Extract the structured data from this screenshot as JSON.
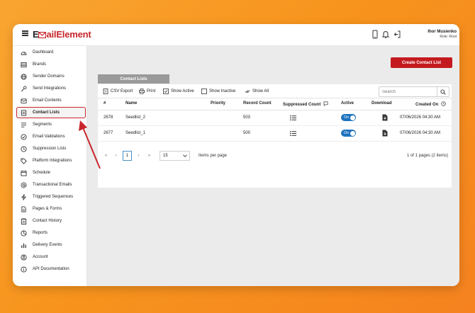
{
  "app": {
    "logo_part1": "E",
    "logo_part2": "ailElement",
    "brand_color": "#c8262b"
  },
  "header": {
    "user_name": "Ihor Musienko",
    "user_role": "Role: Root"
  },
  "sidebar": {
    "items": [
      {
        "label": "Dashboard",
        "icon": "dashboard-icon"
      },
      {
        "label": "Brands",
        "icon": "brands-icon"
      },
      {
        "label": "Sender Domains",
        "icon": "globe-icon"
      },
      {
        "label": "Send Integrations",
        "icon": "key-icon"
      },
      {
        "label": "Email Contents",
        "icon": "envelope-icon"
      },
      {
        "label": "Contact Lists",
        "icon": "contact-list-icon"
      },
      {
        "label": "Segments",
        "icon": "segments-icon"
      },
      {
        "label": "Email Validations",
        "icon": "check-circle-icon"
      },
      {
        "label": "Suppression Lists",
        "icon": "clock-icon"
      },
      {
        "label": "Platform Integrations",
        "icon": "tag-icon"
      },
      {
        "label": "Schedule",
        "icon": "calendar-icon"
      },
      {
        "label": "Transactional Emails",
        "icon": "at-icon"
      },
      {
        "label": "Triggered Sequences",
        "icon": "lightning-icon"
      },
      {
        "label": "Pages & Forms",
        "icon": "pages-icon"
      },
      {
        "label": "Contact History",
        "icon": "clipboard-icon"
      },
      {
        "label": "Reports",
        "icon": "pie-chart-icon"
      },
      {
        "label": "Delivery Events",
        "icon": "bar-chart-icon"
      },
      {
        "label": "Account",
        "icon": "user-icon"
      },
      {
        "label": "API Documentation",
        "icon": "info-icon"
      }
    ],
    "active_index": 5
  },
  "main": {
    "create_button": "Create Contact List",
    "panel_title": "Contact Lists",
    "toolbar": {
      "csv_export": "CSV Export",
      "print": "Print",
      "show_active": "Show Active",
      "show_inactive": "Show Inactive",
      "show_all": "Show All"
    },
    "search": {
      "placeholder": "Search",
      "value": ""
    },
    "table": {
      "columns": [
        "#",
        "Name",
        "Priority",
        "Record Count",
        "Suppressed Count",
        "Active",
        "Download",
        "Created On"
      ],
      "rows": [
        {
          "id": "2678",
          "name": "Seedlist_2",
          "priority": "",
          "record_count": "503",
          "active": "On",
          "created_on": "07/06/2026 04:30 AM"
        },
        {
          "id": "2677",
          "name": "Seedlist_1",
          "priority": "",
          "record_count": "500",
          "active": "On",
          "created_on": "07/06/2026 04:30 AM"
        }
      ]
    },
    "pager": {
      "first": "«",
      "prev": "‹",
      "current_page": "1",
      "next": "›",
      "last": "»",
      "page_size": "15",
      "per_page_label": "Items per page",
      "info": "1 of 1 pages (2 items)"
    }
  },
  "colors": {
    "accent": "#c41a1f",
    "toggle_on": "#1e73be",
    "background": "#f7941d"
  }
}
